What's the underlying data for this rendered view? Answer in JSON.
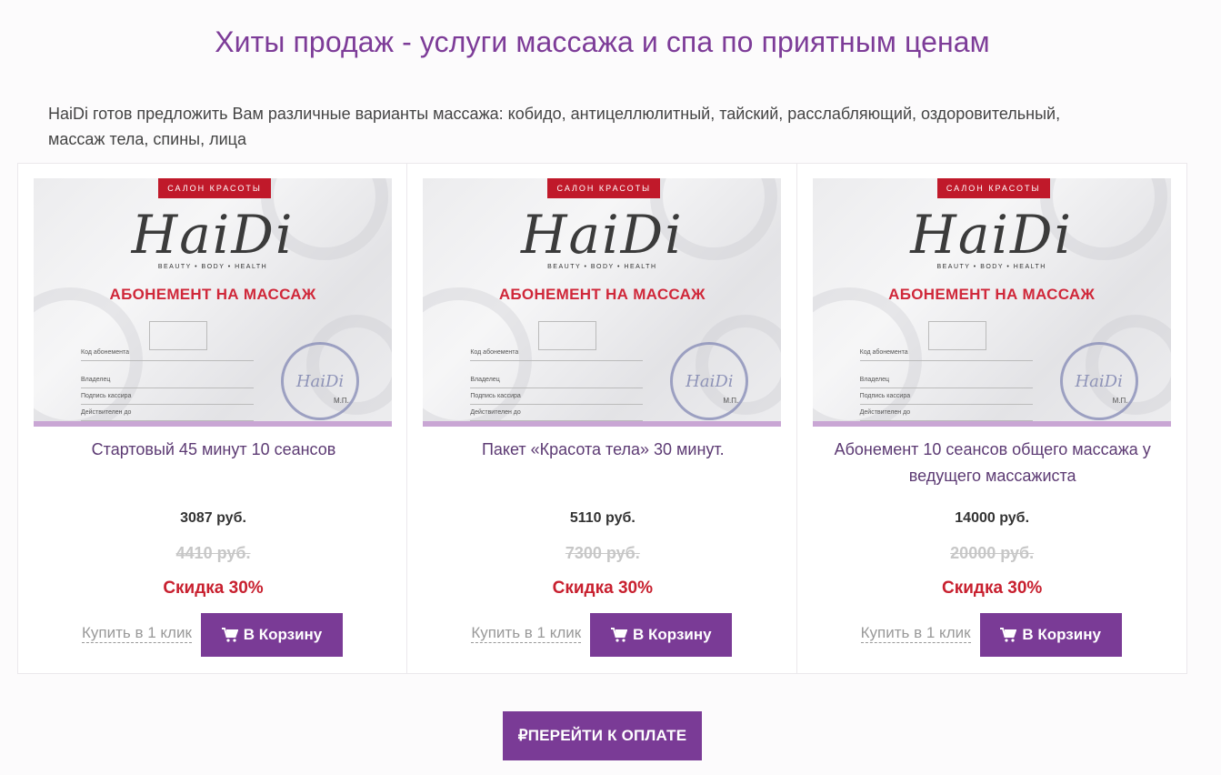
{
  "section": {
    "title": "Хиты продаж - услуги массажа и спа по приятным ценам",
    "intro": "HaiDi готов предложить Вам различные варианты массажа: кобидо, антицеллюлитный, тайский, расслабляющий, оздоровительный, массаж тела, спины, лица"
  },
  "certificate": {
    "salon_tag": "САЛОН КРАСОТЫ",
    "logo": "HaiDi",
    "logo_sub": "BEAUTY • BODY • HEALTH",
    "heading": "АБОНЕМЕНТ НА МАССАЖ",
    "field_code": "Код абонемента",
    "field_owner": "Владелец",
    "field_cashier": "Подпись кассира",
    "field_valid": "Действителен до",
    "stamp_text": "HaiDi",
    "mp": "М.П."
  },
  "products": [
    {
      "title": "Стартовый 45 минут 10 сеансов",
      "price": "3087 руб.",
      "old_price": "4410 руб.",
      "discount": "Скидка 30%",
      "one_click": "Купить в 1 клик",
      "cart_label": "В Корзину"
    },
    {
      "title": "Пакет «Красота тела» 30 минут.",
      "price": "5110 руб.",
      "old_price": "7300 руб.",
      "discount": "Скидка 30%",
      "one_click": "Купить в 1 клик",
      "cart_label": "В Корзину"
    },
    {
      "title": "Абонемент 10 сеансов общего массажа у ведущего массажиста",
      "price": "14000 руб.",
      "old_price": "20000 руб.",
      "discount": "Скидка 30%",
      "one_click": "Купить в 1 клик",
      "cart_label": "В Корзину"
    }
  ],
  "checkout": {
    "label": "₽ПЕРЕЙТИ К ОПЛАТЕ"
  },
  "icons": {
    "cart": "shopping-cart-icon"
  },
  "colors": {
    "accent": "#7a3b96",
    "title": "#7d3c98",
    "discount": "#c8202f",
    "certificate_red": "#c0192a"
  }
}
